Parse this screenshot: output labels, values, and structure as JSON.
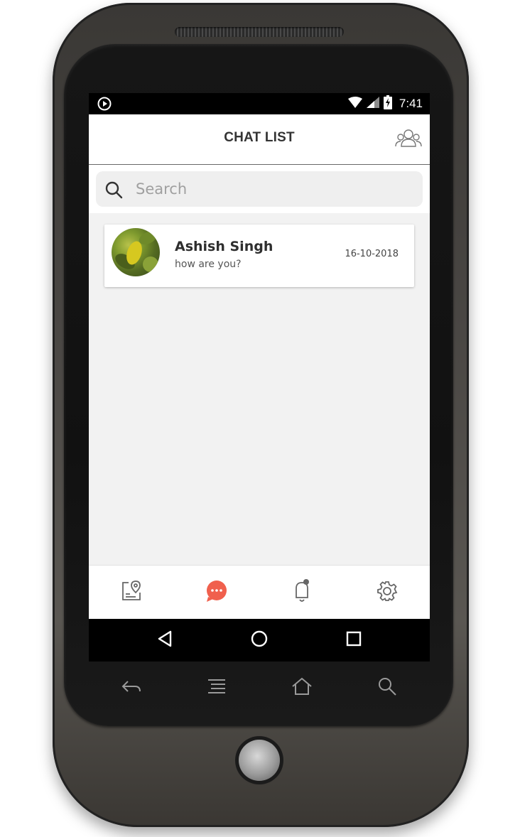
{
  "status_bar": {
    "time": "7:41"
  },
  "header": {
    "title": "CHAT LIST",
    "group_icon": "group-users-icon"
  },
  "search": {
    "placeholder": "Search",
    "value": ""
  },
  "chats": [
    {
      "name": "Ashish Singh",
      "message": "how are you?",
      "date": "16-10-2018"
    }
  ],
  "bottom_nav": {
    "tabs": [
      {
        "icon": "map-pin-card-icon",
        "active": false
      },
      {
        "icon": "chat-bubble-icon",
        "active": true
      },
      {
        "icon": "bell-icon",
        "active": false
      },
      {
        "icon": "gear-icon",
        "active": false
      }
    ]
  },
  "colors": {
    "accent": "#f0604d",
    "background": "#f2f2f2",
    "title_text": "#333333"
  }
}
